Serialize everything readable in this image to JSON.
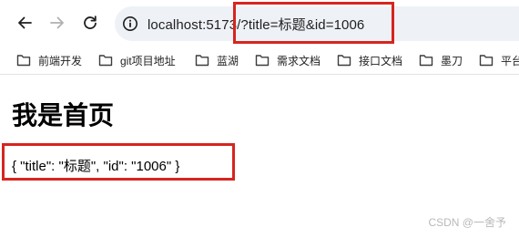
{
  "toolbar": {
    "url": "localhost:5173/?title=标题&id=1006",
    "icons": {
      "back": "arrow-left-icon",
      "forward": "arrow-right-icon",
      "reload": "reload-icon",
      "site_info": "site-info-icon"
    }
  },
  "bookmarks": [
    {
      "label": "前端开发",
      "icon": "folder-icon"
    },
    {
      "label": "git项目地址",
      "icon": "folder-icon"
    },
    {
      "label": "蓝湖",
      "icon": "folder-icon"
    },
    {
      "label": "需求文档",
      "icon": "folder-icon"
    },
    {
      "label": "接口文档",
      "icon": "folder-icon"
    },
    {
      "label": "墨刀",
      "icon": "folder-icon"
    },
    {
      "label": "平台",
      "icon": "folder-icon"
    }
  ],
  "page": {
    "heading": "我是首页",
    "query_output": "{ \"title\": \"标题\", \"id\": \"1006\" }"
  },
  "watermark": "CSDN @一舍予",
  "colors": {
    "highlight": "#d6251f",
    "omnibox_bg": "#eef1f6",
    "text": "#1f1f1f"
  }
}
